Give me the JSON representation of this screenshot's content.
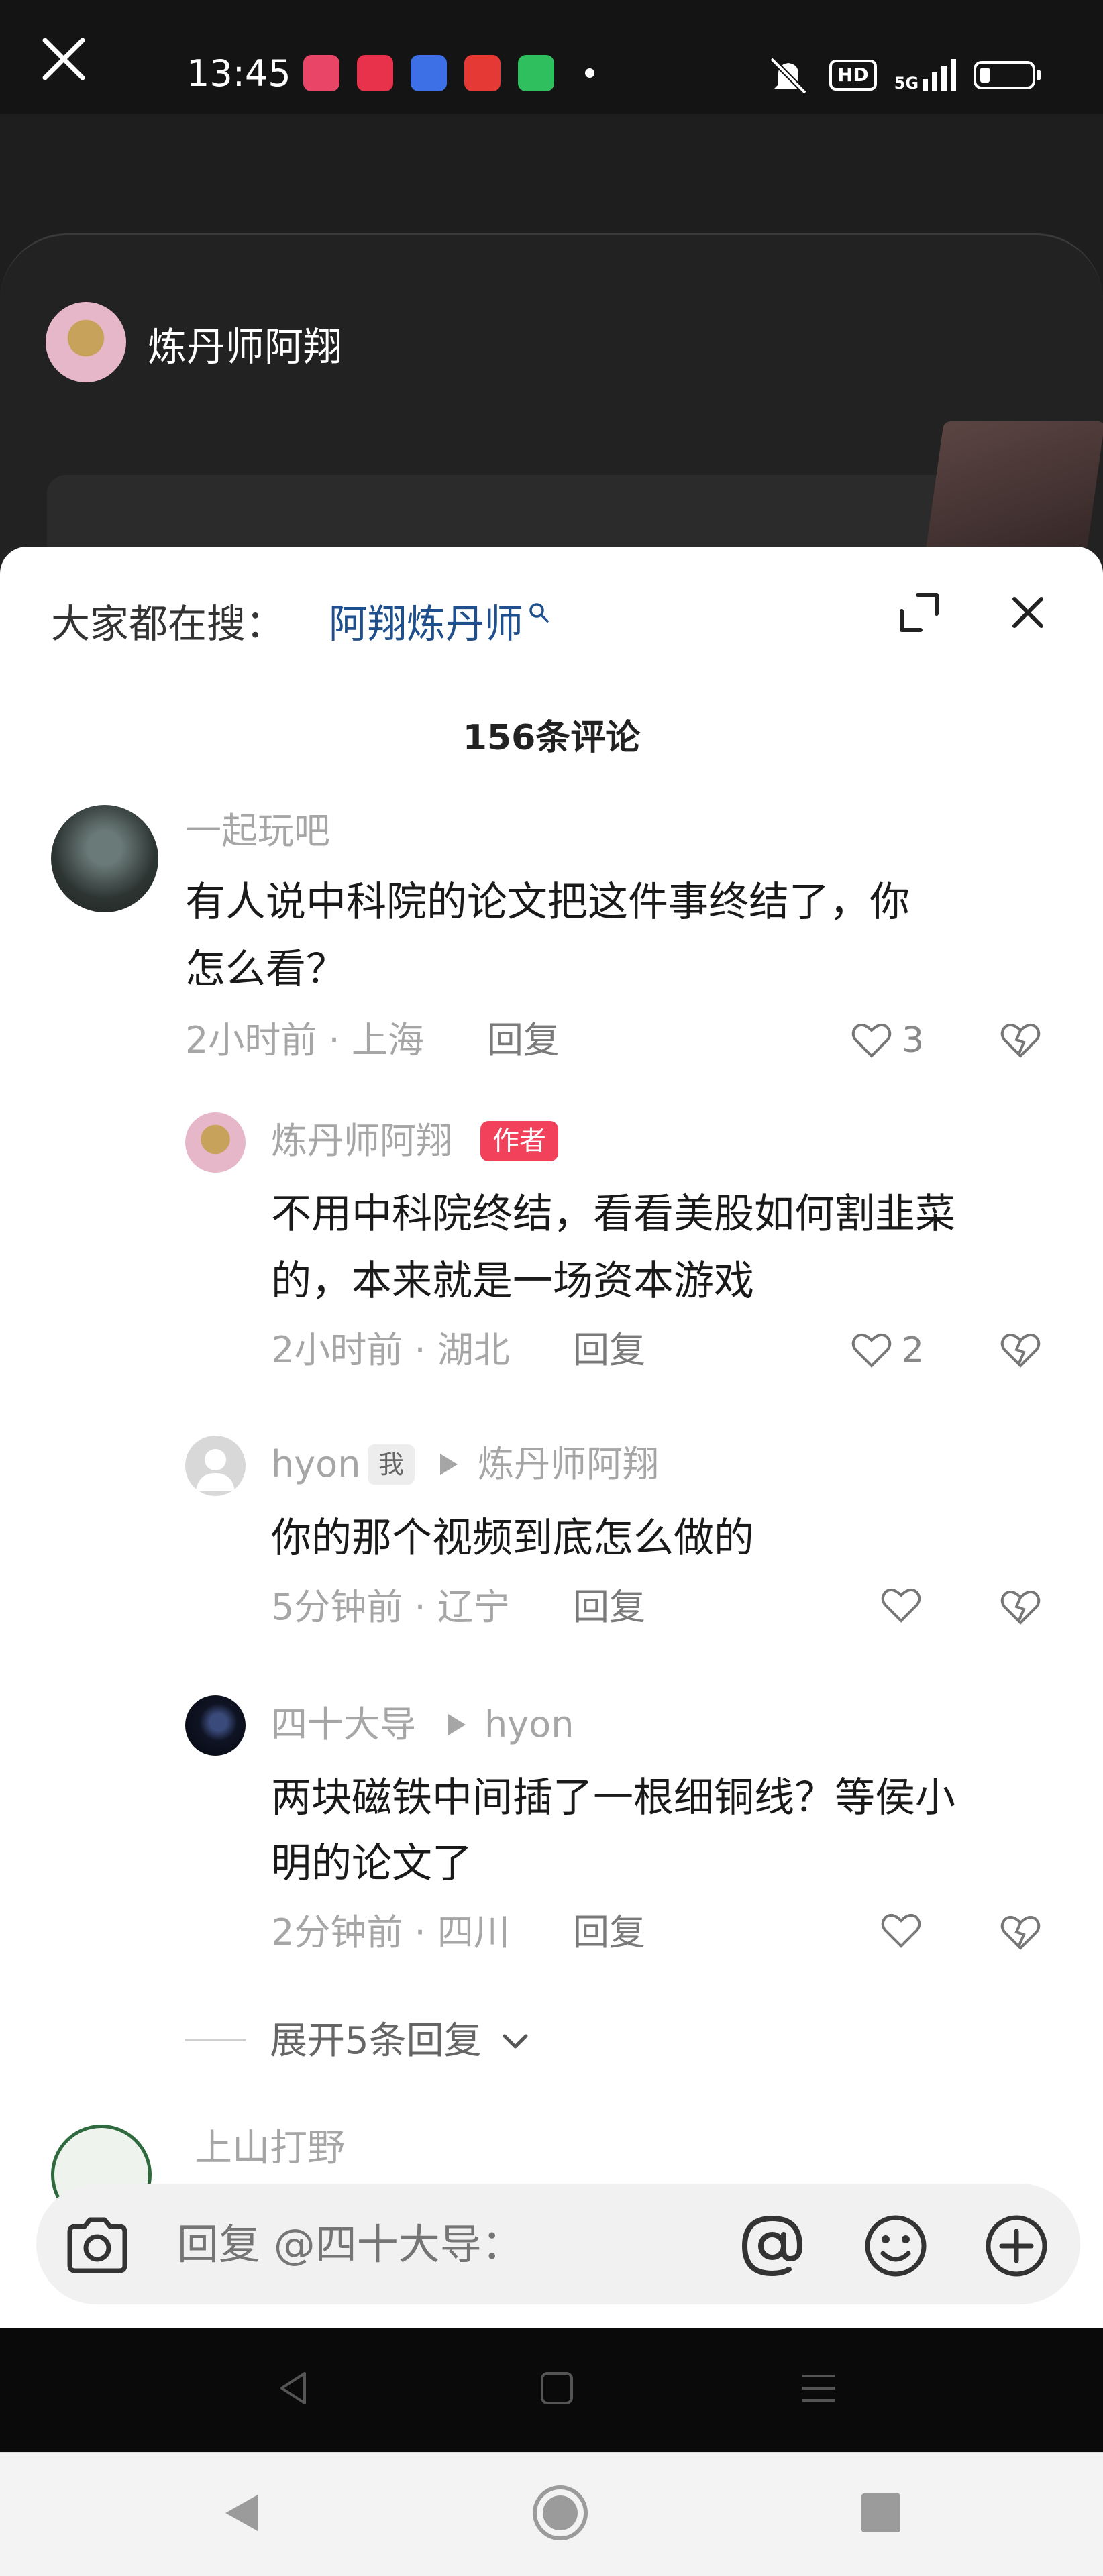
{
  "status_bar": {
    "time": "13:45",
    "app_icons": [
      {
        "name": "pinduoduo-icon",
        "color": "#e94567"
      },
      {
        "name": "app-red-icon",
        "color": "#e8314a"
      },
      {
        "name": "baidu-icon",
        "color": "#3d6fe6"
      },
      {
        "name": "toutiao-icon",
        "color": "#e53935"
      },
      {
        "name": "shop-green-icon",
        "color": "#2fbf5f"
      }
    ],
    "hd_label": "HD",
    "network_label": "5G"
  },
  "video": {
    "author_name": "炼丹师阿翔"
  },
  "sheet": {
    "search_label": "大家都在搜：",
    "search_link": "阿翔炼丹师",
    "comment_count_title": "156条评论",
    "expand_replies_label": "展开5条回复",
    "next_username": "上山打野"
  },
  "comments": [
    {
      "username": "一起玩吧",
      "text_line1": "有人说中科院的论文把这件事终结了，你",
      "text_line2": "怎么看？",
      "meta": "2小时前 · 上海",
      "reply_label": "回复",
      "likes": "3"
    },
    {
      "username": "炼丹师阿翔",
      "badge": "作者",
      "text_line1": "不用中科院终结，看看美股如何割韭菜",
      "text_line2": "的，本来就是一场资本游戏",
      "meta": "2小时前 · 湖北",
      "reply_label": "回复",
      "likes": "2"
    },
    {
      "username": "hyon",
      "badge": "我",
      "reply_to": "炼丹师阿翔",
      "text_line1": "你的那个视频到底怎么做的",
      "meta": "5分钟前 · 辽宁",
      "reply_label": "回复",
      "likes": ""
    },
    {
      "username": "四十大导",
      "reply_to": "hyon",
      "text_line1": "两块磁铁中间插了一根细铜线？等侯小",
      "text_line2": "明的论文了",
      "meta": "2分钟前 · 四川",
      "reply_label": "回复",
      "likes": ""
    }
  ],
  "input_bar": {
    "placeholder": "回复 @四十大导："
  },
  "colors": {
    "link_blue": "#1f4f8c",
    "author_badge": "#f2415a",
    "muted_text": "#a6a6a6"
  }
}
